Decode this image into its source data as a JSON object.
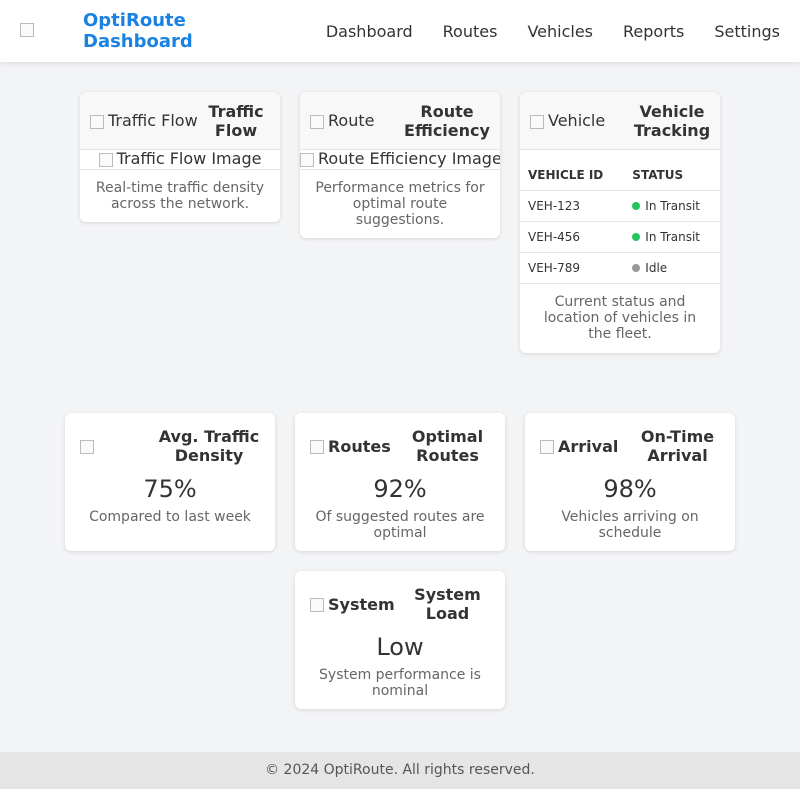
{
  "header": {
    "brand": "OptiRoute Dashboard",
    "nav": [
      "Dashboard",
      "Routes",
      "Vehicles",
      "Reports",
      "Settings"
    ]
  },
  "cards": {
    "traffic": {
      "alt": "Traffic Flow",
      "title": "Traffic Flow",
      "image_alt": "Traffic Flow Image",
      "desc": "Real-time traffic density across the network."
    },
    "route": {
      "alt": "Route",
      "title": "Route Efficiency",
      "image_alt": "Route Efficiency Image",
      "desc": "Performance metrics for optimal route suggestions."
    },
    "vehicle": {
      "alt": "Vehicle",
      "title": "Vehicle Tracking",
      "columns": [
        "VEHICLE ID",
        "STATUS"
      ],
      "rows": [
        {
          "id": "VEH-123",
          "status": "In Transit",
          "color": "#22c55e"
        },
        {
          "id": "VEH-456",
          "status": "In Transit",
          "color": "#22c55e"
        },
        {
          "id": "VEH-789",
          "status": "Idle",
          "color": "#999999"
        }
      ],
      "desc": "Current status and location of vehicles in the fleet."
    }
  },
  "stats": {
    "density": {
      "alt": "",
      "title": "Avg. Traffic Density",
      "value": "75%",
      "desc": "Compared to last week"
    },
    "optimal": {
      "alt": "Routes",
      "title": "Optimal Routes",
      "value": "92%",
      "desc": "Of suggested routes are optimal"
    },
    "arrival": {
      "alt": "Arrival",
      "title": "On-Time Arrival",
      "value": "98%",
      "desc": "Vehicles arriving on schedule"
    },
    "load": {
      "alt": "System",
      "title": "System Load",
      "value": "Low",
      "desc": "System performance is nominal"
    }
  },
  "footer": "© 2024 OptiRoute. All rights reserved."
}
